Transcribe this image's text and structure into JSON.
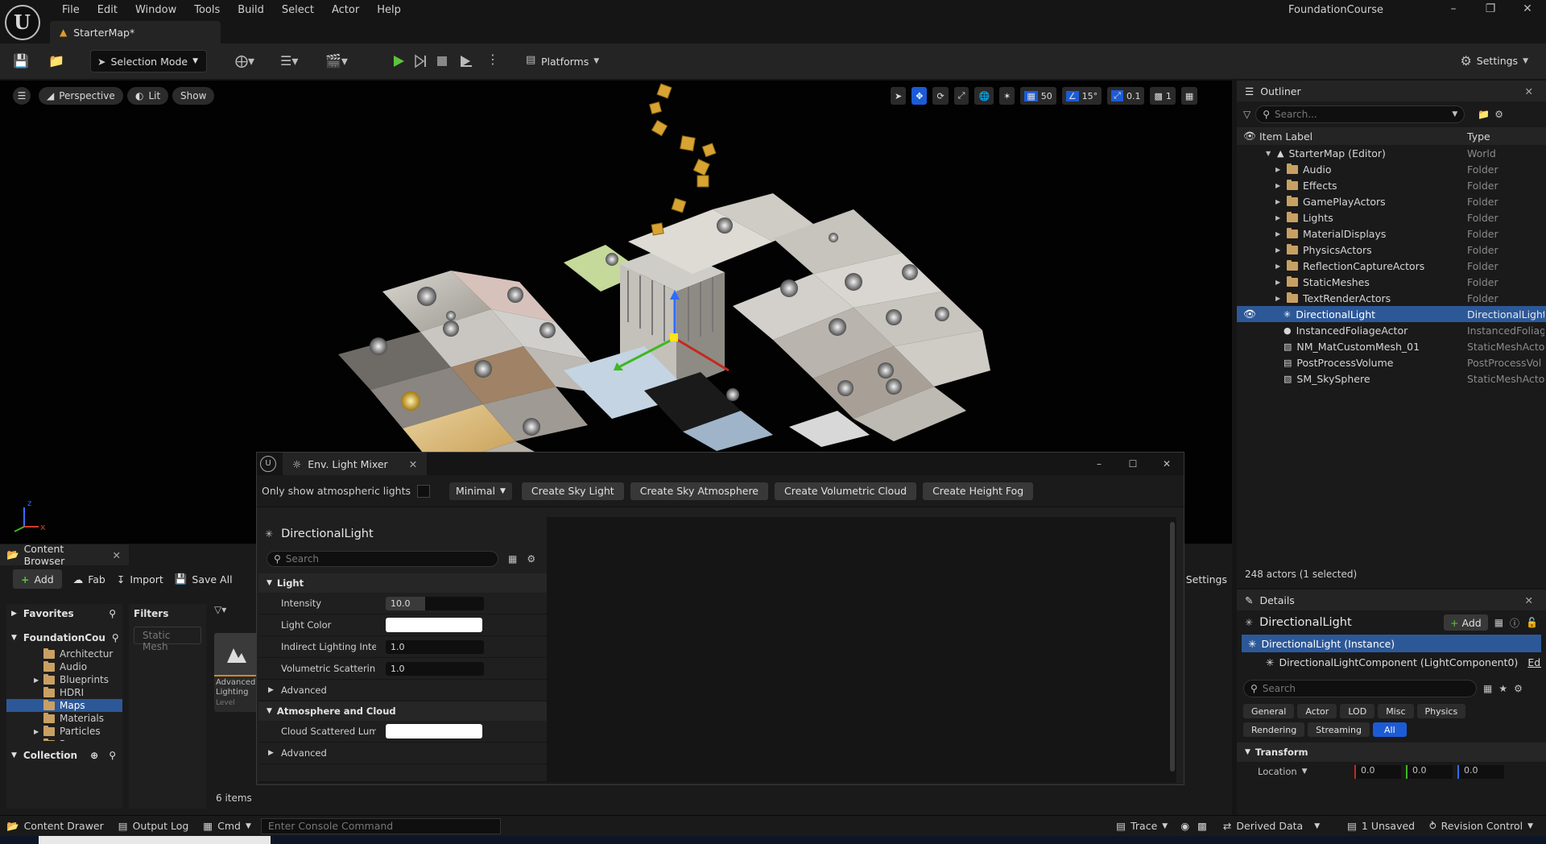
{
  "app": {
    "project_name": "FoundationCourse",
    "map_tab": "StarterMap*",
    "menus": [
      "File",
      "Edit",
      "Window",
      "Tools",
      "Build",
      "Select",
      "Actor",
      "Help"
    ]
  },
  "toolbar": {
    "selection_mode": "Selection Mode",
    "platforms": "Platforms",
    "settings": "Settings"
  },
  "viewport": {
    "perspective": "Perspective",
    "lit": "Lit",
    "show": "Show",
    "grid_snap": "50",
    "rotation_snap": "15°",
    "scale_snap": "0.1",
    "camera_speed": "1"
  },
  "outliner": {
    "tab": "Outliner",
    "search_placeholder": "Search...",
    "col_label": "Item Label",
    "col_type": "Type",
    "rows": [
      {
        "label": "StarterMap (Editor)",
        "type": "World",
        "kind": "world"
      },
      {
        "label": "Audio",
        "type": "Folder",
        "kind": "folder"
      },
      {
        "label": "Effects",
        "type": "Folder",
        "kind": "folder"
      },
      {
        "label": "GamePlayActors",
        "type": "Folder",
        "kind": "folder"
      },
      {
        "label": "Lights",
        "type": "Folder",
        "kind": "folder"
      },
      {
        "label": "MaterialDisplays",
        "type": "Folder",
        "kind": "folder"
      },
      {
        "label": "PhysicsActors",
        "type": "Folder",
        "kind": "folder"
      },
      {
        "label": "ReflectionCaptureActors",
        "type": "Folder",
        "kind": "folder"
      },
      {
        "label": "StaticMeshes",
        "type": "Folder",
        "kind": "folder"
      },
      {
        "label": "TextRenderActors",
        "type": "Folder",
        "kind": "folder"
      },
      {
        "label": "DirectionalLight",
        "type": "DirectionalLight",
        "kind": "light",
        "selected": true
      },
      {
        "label": "InstancedFoliageActor",
        "type": "InstancedFoliage",
        "kind": "actor"
      },
      {
        "label": "NM_MatCustomMesh_01",
        "type": "StaticMeshActor",
        "kind": "mesh"
      },
      {
        "label": "PostProcessVolume",
        "type": "PostProcessVol",
        "kind": "volume"
      },
      {
        "label": "SM_SkySphere",
        "type": "StaticMeshActor",
        "kind": "mesh"
      }
    ],
    "actor_count": "248 actors (1 selected)"
  },
  "details": {
    "tab": "Details",
    "actor_name": "DirectionalLight",
    "add_label": "Add",
    "instance": "DirectionalLight (Instance)",
    "component": "DirectionalLightComponent (LightComponent0)",
    "edit_link": "Edit in C",
    "search_placeholder": "Search",
    "filters_row1": [
      "General",
      "Actor",
      "LOD",
      "Misc",
      "Physics"
    ],
    "filters_row2": [
      "Rendering",
      "Streaming",
      "All"
    ],
    "section": "Transform",
    "location_label": "Location",
    "location": [
      "0.0",
      "0.0",
      "0.0"
    ]
  },
  "content_browser": {
    "tab": "Content Browser",
    "add": "Add",
    "fab": "Fab",
    "import": "Import",
    "save_all": "Save All",
    "settings": "Settings",
    "favorites": "Favorites",
    "root": "FoundationCou",
    "folders": [
      "Architectur",
      "Audio",
      "Blueprints",
      "HDRI",
      "Maps",
      "Materials",
      "Particles",
      "Props"
    ],
    "selected_folder": "Maps",
    "collections": "Collection",
    "filters": "Filters",
    "filter_chip": "Static Mesh",
    "asset_name": "Advanced Lighting",
    "asset_type": "Level",
    "items_count": "6 items"
  },
  "mixer": {
    "title": "Env. Light Mixer",
    "only_atmospheric": "Only show atmospheric lights",
    "mode": "Minimal",
    "buttons": [
      "Create Sky Light",
      "Create Sky Atmosphere",
      "Create Volumetric Cloud",
      "Create Height Fog"
    ],
    "light_name": "DirectionalLight",
    "search_placeholder": "Search",
    "section_light": "Light",
    "intensity_label": "Intensity",
    "intensity": "10.0",
    "light_color_label": "Light Color",
    "indirect_label": "Indirect Lighting Inten...",
    "indirect": "1.0",
    "volumetric_label": "Volumetric Scatterin...",
    "volumetric": "1.0",
    "advanced": "Advanced",
    "section_atmo": "Atmosphere and Cloud",
    "cloud_label": "Cloud Scattered Lumi..."
  },
  "status": {
    "content_drawer": "Content Drawer",
    "output_log": "Output Log",
    "cmd": "Cmd",
    "console_placeholder": "Enter Console Command",
    "trace": "Trace",
    "derived_data": "Derived Data",
    "unsaved": "1 Unsaved",
    "revision_control": "Revision Control"
  }
}
